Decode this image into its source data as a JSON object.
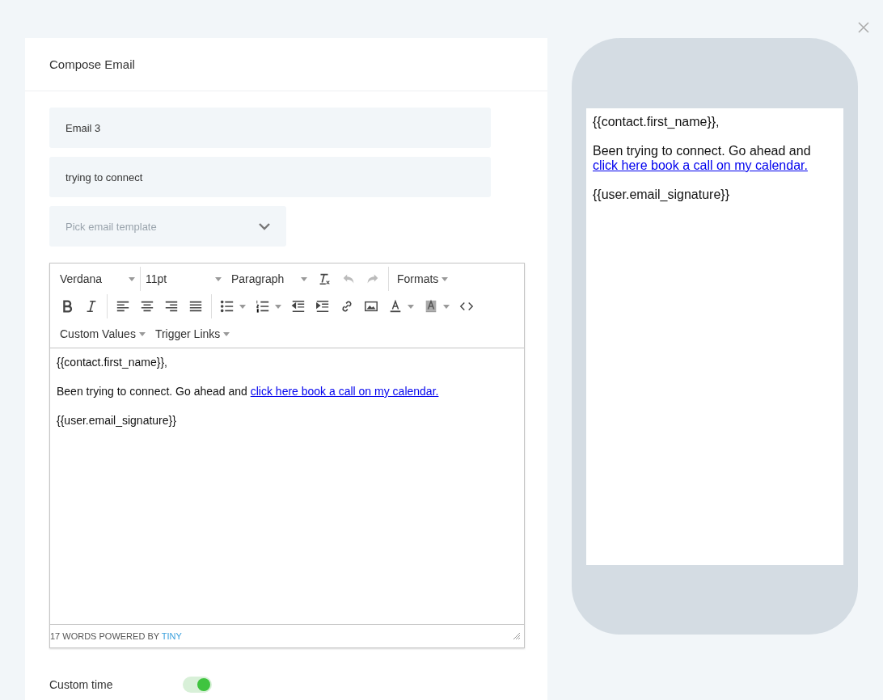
{
  "title": "Compose Email",
  "fields": [
    {
      "value": "Email 3"
    },
    {
      "value": "trying to connect"
    }
  ],
  "template_select": {
    "placeholder": "Pick email template"
  },
  "toolbar": [
    [
      [
        {
          "kind": "select",
          "label": "Verdana"
        },
        {
          "kind": "select",
          "label": "11pt"
        },
        {
          "kind": "select",
          "label": "Paragraph"
        },
        {
          "kind": "clearformat",
          "disabled": false
        },
        {
          "kind": "undo",
          "disabled": true
        },
        {
          "kind": "redo",
          "disabled": true
        }
      ],
      [
        {
          "kind": "menu",
          "label": "Formats"
        }
      ]
    ],
    [
      [
        {
          "kind": "bold",
          "disabled": false
        },
        {
          "kind": "italic",
          "disabled": false
        }
      ],
      [
        {
          "kind": "alignleft",
          "disabled": false
        },
        {
          "kind": "aligncenter",
          "disabled": false
        },
        {
          "kind": "alignright",
          "disabled": false
        },
        {
          "kind": "justify",
          "disabled": false
        }
      ],
      [
        {
          "kind": "bullets",
          "disabled": false,
          "has_menu": true
        },
        {
          "kind": "numbers",
          "disabled": false,
          "has_menu": true
        },
        {
          "kind": "outdent",
          "disabled": false
        },
        {
          "kind": "indent",
          "disabled": false
        },
        {
          "kind": "link",
          "disabled": false
        },
        {
          "kind": "image",
          "disabled": false
        },
        {
          "kind": "textcolor",
          "disabled": false,
          "has_menu": true
        },
        {
          "kind": "backcolor",
          "disabled": false,
          "has_menu": true
        },
        {
          "kind": "code",
          "disabled": false
        }
      ]
    ],
    [
      [
        {
          "kind": "menu",
          "label": "Custom Values"
        },
        {
          "kind": "menu",
          "label": "Trigger Links"
        }
      ]
    ]
  ],
  "editor_body": [
    {
      "text": "{{contact.first_name}},"
    },
    {
      "text": "Been trying to connect. Go ahead and",
      "link": "click here book a call on my calendar."
    },
    {
      "text": "{{user.email_signature}}"
    }
  ],
  "status_bar": {
    "text": "17 WORDS POWERED BY",
    "brand": "TINY"
  },
  "custom_time": {
    "label": "Custom time",
    "on": true
  },
  "preview": [
    {
      "text": "{{contact.first_name}},"
    },
    {
      "text": "Been trying to connect. Go ahead and",
      "link": "click here book a call on my calendar."
    },
    {
      "text": "{{user.email_signature}}"
    }
  ]
}
